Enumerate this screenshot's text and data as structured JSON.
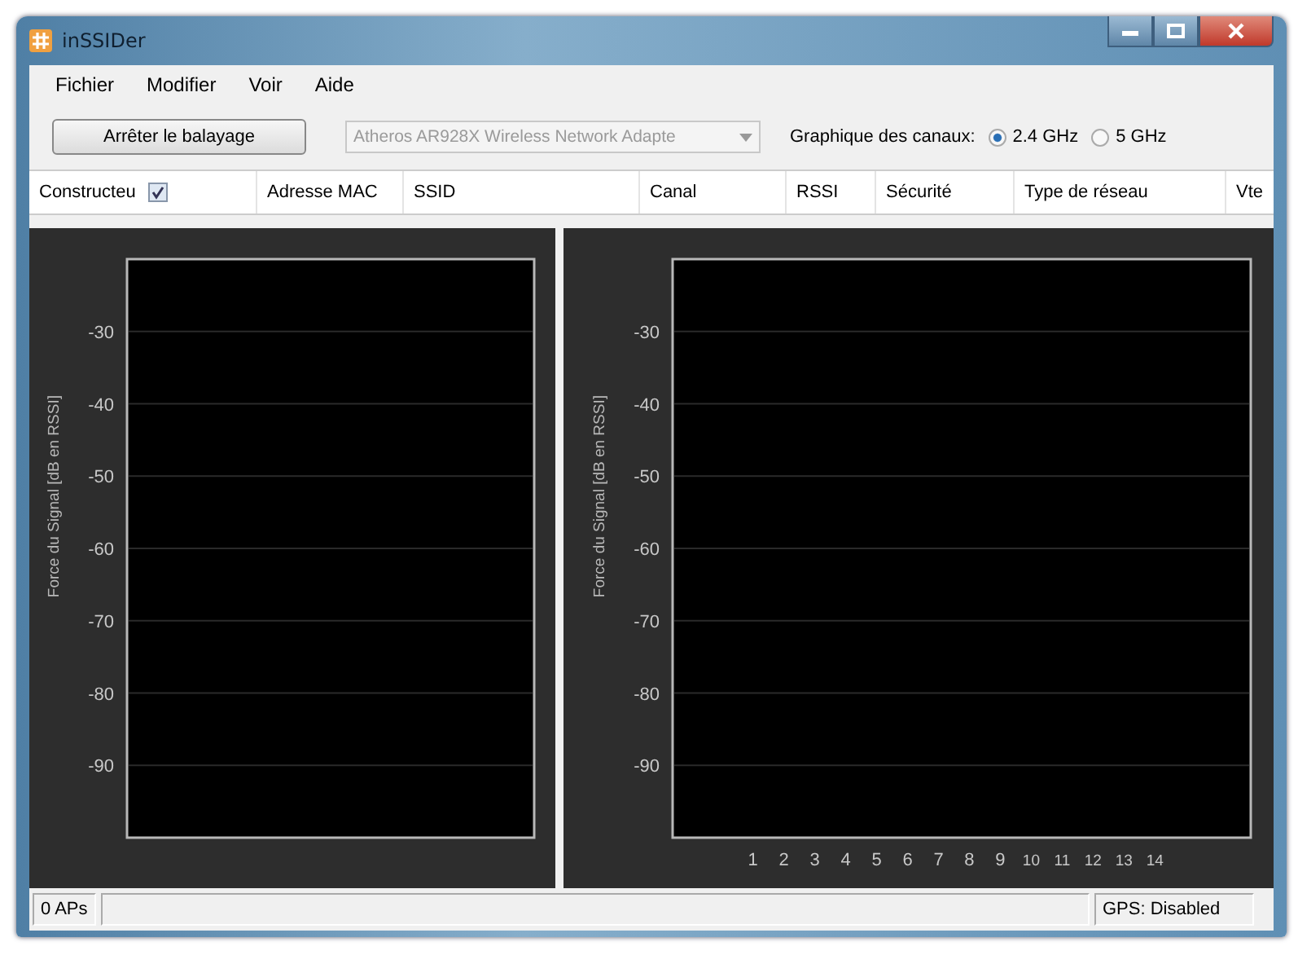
{
  "window": {
    "title": "inSSIDer"
  },
  "menu": [
    {
      "label": "Fichier"
    },
    {
      "label": "Modifier"
    },
    {
      "label": "Voir"
    },
    {
      "label": "Aide"
    }
  ],
  "toolbar": {
    "scan_button": "Arrêter le balayage",
    "adapter": {
      "value": "Atheros AR928X Wireless Network Adapte",
      "disabled": true
    },
    "channel_graph_label": "Graphique des canaux:",
    "bands": [
      {
        "label": "2.4 GHz",
        "selected": true
      },
      {
        "label": "5 GHz",
        "selected": false
      }
    ]
  },
  "table": {
    "columns": [
      {
        "label": "Constructeu",
        "checked": true
      },
      {
        "label": "Adresse MAC"
      },
      {
        "label": "SSID"
      },
      {
        "label": "Canal"
      },
      {
        "label": "RSSI"
      },
      {
        "label": "Sécurité"
      },
      {
        "label": "Type de réseau"
      },
      {
        "label": "Vte"
      }
    ]
  },
  "charts": [
    {
      "chart_data": {
        "type": "line",
        "categories": [
          null
        ],
        "grid": true,
        "ylabel": "Force du Signal [dB en RSSI]",
        "ylim": [
          -100,
          -20
        ],
        "yticks": [
          -30,
          -40,
          -50,
          -60,
          -70,
          -80,
          -90
        ]
      }
    },
    {
      "chart_data": {
        "type": "line",
        "grid": true,
        "ylabel": "Force du Signal [dB en RSSI]",
        "ylim": [
          -100,
          -20
        ],
        "yticks": [
          -30,
          -40,
          -50,
          -60,
          -70,
          -80,
          -90
        ],
        "xlim": [
          -1.6,
          17.1
        ],
        "xticks": [
          1,
          2,
          3,
          4,
          5,
          6,
          7,
          8,
          9,
          10,
          11,
          12,
          13,
          14
        ]
      }
    }
  ],
  "status_bar": {
    "ap_count": "0 APs",
    "gps": "GPS: Disabled"
  }
}
